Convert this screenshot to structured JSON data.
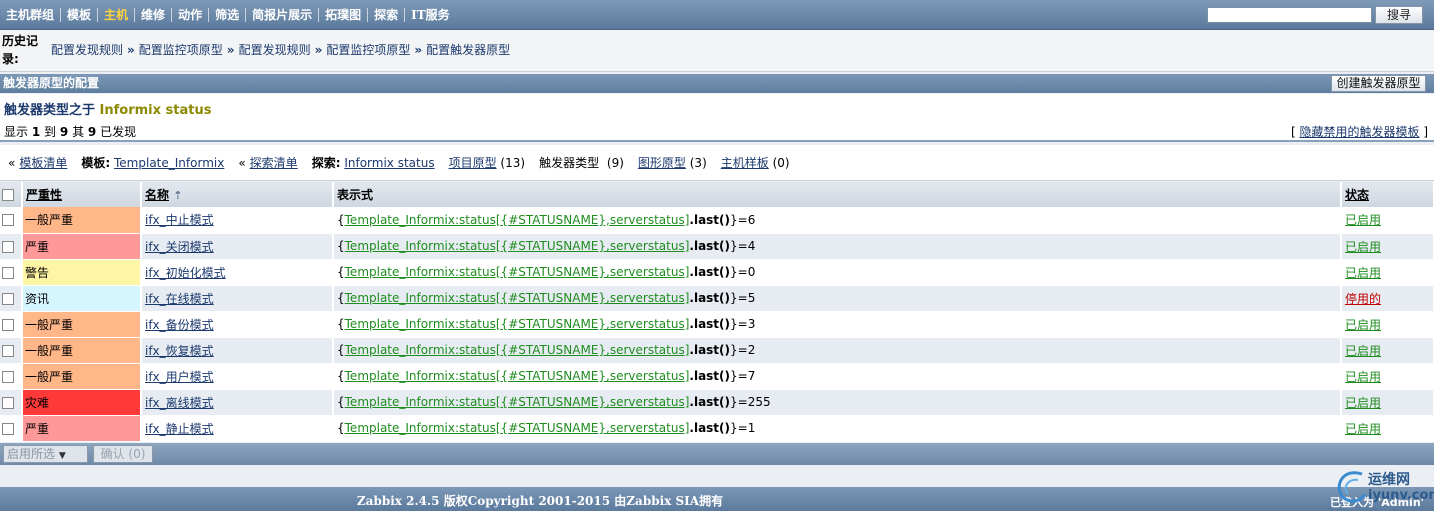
{
  "nav": {
    "items": [
      "主机群组",
      "模板",
      "主机",
      "维修",
      "动作",
      "筛选",
      "简报片展示",
      "拓璞图",
      "探索",
      "IT服务"
    ],
    "search_button": "搜寻"
  },
  "history": {
    "label": "历史记录:",
    "crumbs": [
      "配置发现规则",
      "配置监控项原型",
      "配置发现规则",
      "配置监控项原型",
      "配置触发器原型"
    ]
  },
  "section": {
    "title": "触发器原型的配置",
    "create_button": "创建触发器原型"
  },
  "subtitle": {
    "prefix": "触发器类型之于",
    "name": "Informix status"
  },
  "counts": {
    "showing": "显示",
    "from": "1",
    "to_label": "到",
    "to": "9",
    "of_label": "其",
    "total": "9",
    "found": "已发现",
    "hide_disabled": "隐藏禁用的触发器模板"
  },
  "filters": {
    "template_list": "模板清单",
    "template_label": "模板:",
    "template_value": "Template_Informix",
    "discovery_list": "探索清单",
    "discovery_label": "探索:",
    "discovery_value": "Informix status",
    "item_prototypes": "项目原型",
    "item_prototypes_count": "(13)",
    "trigger_types": "触发器类型",
    "trigger_types_count": "(9)",
    "graph_prototypes": "图形原型",
    "graph_prototypes_count": "(3)",
    "host_templates": "主机样板",
    "host_templates_count": "(0)"
  },
  "table": {
    "headers": {
      "severity": "严重性",
      "name": "名称",
      "expression": "表示式",
      "status": "状态"
    },
    "rows": [
      {
        "severity": "一般严重",
        "sev_color": "#ffb689",
        "name": "ifx_中止模式",
        "expr": "Template_Informix:status[{#STATUSNAME},serverstatus]",
        "fn": ".last()",
        "cmp": "=6",
        "status": "已启用",
        "enabled": true
      },
      {
        "severity": "严重",
        "sev_color": "#ff9999",
        "name": "ifx_关闭模式",
        "expr": "Template_Informix:status[{#STATUSNAME},serverstatus]",
        "fn": ".last()",
        "cmp": "=4",
        "status": "已启用",
        "enabled": true
      },
      {
        "severity": "警告",
        "sev_color": "#fff6a5",
        "name": "ifx_初始化模式",
        "expr": "Template_Informix:status[{#STATUSNAME},serverstatus]",
        "fn": ".last()",
        "cmp": "=0",
        "status": "已启用",
        "enabled": true
      },
      {
        "severity": "资讯",
        "sev_color": "#d6f6ff",
        "name": "ifx_在线模式",
        "expr": "Template_Informix:status[{#STATUSNAME},serverstatus]",
        "fn": ".last()",
        "cmp": "=5",
        "status": "停用的",
        "enabled": false
      },
      {
        "severity": "一般严重",
        "sev_color": "#ffb689",
        "name": "ifx_备份模式",
        "expr": "Template_Informix:status[{#STATUSNAME},serverstatus]",
        "fn": ".last()",
        "cmp": "=3",
        "status": "已启用",
        "enabled": true
      },
      {
        "severity": "一般严重",
        "sev_color": "#ffb689",
        "name": "ifx_恢复模式",
        "expr": "Template_Informix:status[{#STATUSNAME},serverstatus]",
        "fn": ".last()",
        "cmp": "=2",
        "status": "已启用",
        "enabled": true
      },
      {
        "severity": "一般严重",
        "sev_color": "#ffb689",
        "name": "ifx_用户模式",
        "expr": "Template_Informix:status[{#STATUSNAME},serverstatus]",
        "fn": ".last()",
        "cmp": "=7",
        "status": "已启用",
        "enabled": true
      },
      {
        "severity": "灾难",
        "sev_color": "#ff3838",
        "name": "ifx_离线模式",
        "expr": "Template_Informix:status[{#STATUSNAME},serverstatus]",
        "fn": ".last()",
        "cmp": "=255",
        "status": "已启用",
        "enabled": true
      },
      {
        "severity": "严重",
        "sev_color": "#ff9999",
        "name": "ifx_静止模式",
        "expr": "Template_Informix:status[{#STATUSNAME},serverstatus]",
        "fn": ".last()",
        "cmp": "=1",
        "status": "已启用",
        "enabled": true
      }
    ]
  },
  "actions": {
    "select": "启用所选",
    "confirm": "确认 (0)"
  },
  "footer": {
    "copyright": "Zabbix 2.4.5 版权Copyright 2001-2015 由Zabbix SIA拥有",
    "login": "已登入为 'Admin'"
  },
  "watermark": {
    "line1": "运维网",
    "line2": "iyunv.com"
  },
  "colors": {
    "enabled": "#1f8c1f",
    "disabled": "#c00000",
    "active_nav": "#ffd23d"
  }
}
